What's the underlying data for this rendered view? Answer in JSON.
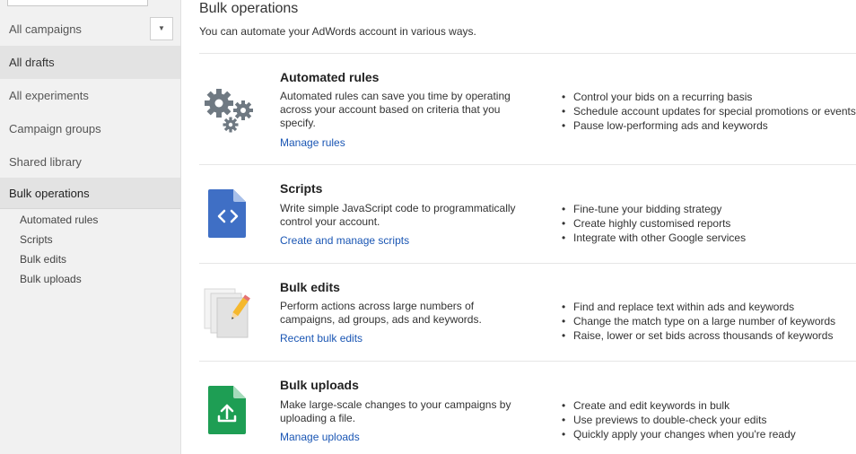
{
  "sidebar": {
    "items": [
      {
        "label": "All campaigns"
      },
      {
        "label": "All drafts"
      },
      {
        "label": "All experiments"
      },
      {
        "label": "Campaign groups"
      },
      {
        "label": "Shared library"
      },
      {
        "label": "Bulk operations"
      }
    ],
    "dropdown_icon": "▼",
    "sub_items": [
      "Automated rules",
      "Scripts",
      "Bulk edits",
      "Bulk uploads"
    ]
  },
  "main": {
    "title": "Bulk operations",
    "subtitle": "You can automate your AdWords account in various ways.",
    "sections": [
      {
        "icon": "gears-icon",
        "title": "Automated rules",
        "description": "Automated rules can save you time by operating across your account based on criteria that you specify.",
        "link": "Manage rules",
        "bullets": [
          "Control your bids on a recurring basis",
          "Schedule account updates for special promotions or events",
          "Pause low-performing ads and keywords"
        ]
      },
      {
        "icon": "script-icon",
        "title": "Scripts",
        "description": "Write simple JavaScript code to programmatically control your account.",
        "link": "Create and manage scripts",
        "bullets": [
          "Fine-tune your bidding strategy",
          "Create highly customised reports",
          "Integrate with other Google services"
        ]
      },
      {
        "icon": "bulk-edit-icon",
        "title": "Bulk edits",
        "description": "Perform actions across large numbers of campaigns, ad groups, ads and keywords.",
        "link": "Recent bulk edits",
        "bullets": [
          "Find and replace text within ads and keywords",
          "Change the match type on a large number of keywords",
          "Raise, lower or set bids across thousands of keywords"
        ]
      },
      {
        "icon": "upload-icon",
        "title": "Bulk uploads",
        "description": "Make large-scale changes to your campaigns by uploading a file.",
        "link": "Manage uploads",
        "bullets": [
          "Create and edit keywords in bulk",
          "Use previews to double-check your edits",
          "Quickly apply your changes when you're ready"
        ]
      }
    ]
  },
  "colors": {
    "link": "#1a56b4",
    "script_blue": "#3f6fc5",
    "upload_green": "#1e9e54",
    "pencil_yellow": "#f5b82e",
    "gear_gray": "#6f7982"
  }
}
